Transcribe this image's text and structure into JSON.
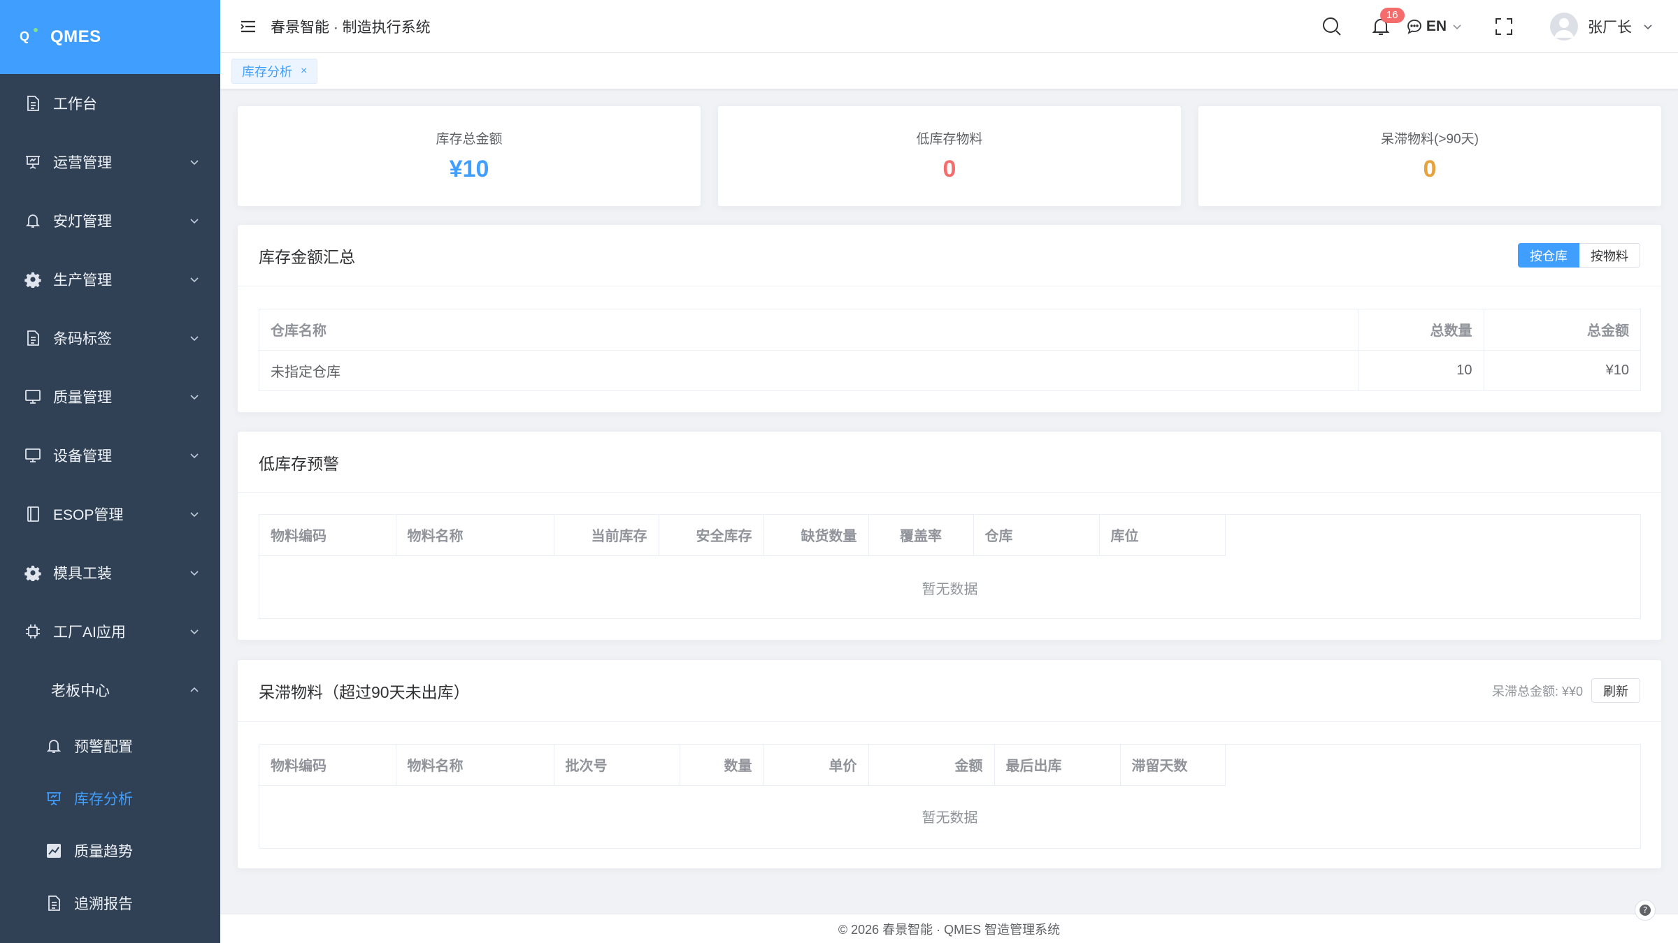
{
  "app": {
    "logo_mark": "Q",
    "name": "QMES",
    "system_title": "春景智能 · 制造执行系统"
  },
  "sidebar": {
    "items": [
      {
        "label": "工作台",
        "icon": "document-icon"
      },
      {
        "label": "运营管理",
        "icon": "presentation-icon"
      },
      {
        "label": "安灯管理",
        "icon": "bell-icon"
      },
      {
        "label": "生产管理",
        "icon": "gear-icon"
      },
      {
        "label": "条码标签",
        "icon": "document-icon"
      },
      {
        "label": "质量管理",
        "icon": "monitor-icon"
      },
      {
        "label": "设备管理",
        "icon": "monitor-icon"
      },
      {
        "label": "ESOP管理",
        "icon": "notebook-icon"
      },
      {
        "label": "模具工装",
        "icon": "gear-icon"
      },
      {
        "label": "工厂AI应用",
        "icon": "chip-icon"
      }
    ],
    "boss_center": {
      "label": "老板中心",
      "children": [
        {
          "label": "预警配置",
          "icon": "bell-icon"
        },
        {
          "label": "库存分析",
          "icon": "presentation-icon"
        },
        {
          "label": "质量趋势",
          "icon": "chart-icon"
        },
        {
          "label": "追溯报告",
          "icon": "document-icon"
        }
      ]
    }
  },
  "header": {
    "notification_count": "16",
    "language": "EN",
    "user_name": "张厂长"
  },
  "tags": {
    "active": "库存分析",
    "close": "×"
  },
  "stats": {
    "total_amount": {
      "label": "库存总金额",
      "value": "¥10",
      "color": "#409eff"
    },
    "low_stock": {
      "label": "低库存物料",
      "value": "0",
      "color": "#f56c6c"
    },
    "stagnant": {
      "label": "呆滞物料(>90天)",
      "value": "0",
      "color": "#e6a23c"
    }
  },
  "summary": {
    "title": "库存金额汇总",
    "toggle": {
      "by_warehouse": "按仓库",
      "by_material": "按物料"
    },
    "columns": [
      "仓库名称",
      "总数量",
      "总金额"
    ],
    "rows": [
      {
        "warehouse": "未指定仓库",
        "qty": "10",
        "amount": "¥10"
      }
    ]
  },
  "low_stock_panel": {
    "title": "低库存预警",
    "columns": [
      "物料编码",
      "物料名称",
      "当前库存",
      "安全库存",
      "缺货数量",
      "覆盖率",
      "仓库",
      "库位"
    ],
    "empty_text": "暂无数据"
  },
  "stagnant_panel": {
    "title": "呆滞物料（超过90天未出库）",
    "total_label": "呆滞总金额: ¥¥0",
    "refresh": "刷新",
    "columns": [
      "物料编码",
      "物料名称",
      "批次号",
      "数量",
      "单价",
      "金额",
      "最后出库",
      "滞留天数"
    ],
    "empty_text": "暂无数据"
  },
  "footer": {
    "text": "© 2026 春景智能 · QMES 智造管理系统"
  },
  "colors": {
    "primary": "#409eff",
    "sidebar_bg": "#304156",
    "danger": "#f56c6c",
    "warning": "#e6a23c"
  }
}
